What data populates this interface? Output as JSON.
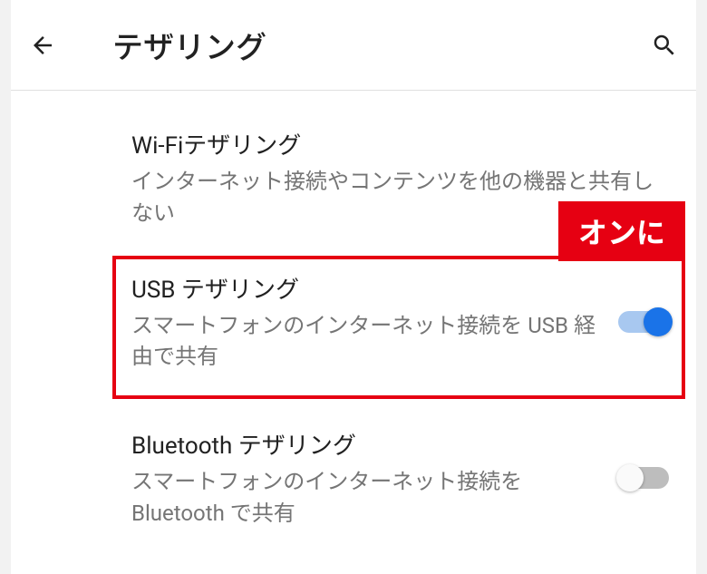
{
  "header": {
    "title": "テザリング"
  },
  "settings": {
    "wifi": {
      "title": "Wi-Fiテザリング",
      "subtitle": "インターネット接続やコンテンツを他の機器と共有しない"
    },
    "usb": {
      "title": "USB テザリング",
      "subtitle": "スマートフォンのインターネット接続を USB 経由で共有"
    },
    "bluetooth": {
      "title": "Bluetooth テザリング",
      "subtitle": "スマートフォンのインターネット接続を Bluetooth で共有"
    }
  },
  "annotation": {
    "label": "オンに"
  },
  "colors": {
    "accent": "#1a73e8",
    "highlight": "#e60012"
  }
}
